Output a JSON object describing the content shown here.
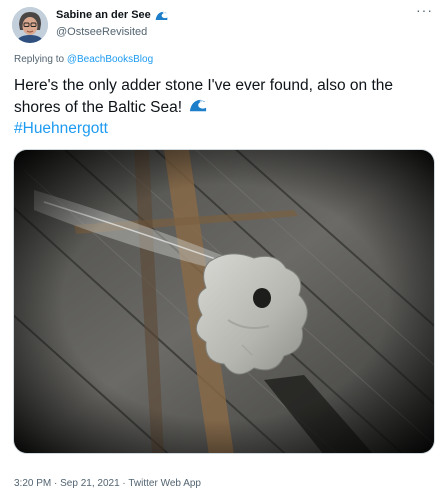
{
  "author": {
    "display_name": "Sabine an der See",
    "name_emoji_icon": "water-wave-icon",
    "handle": "@OstseeRevisited"
  },
  "more_icon": "more-icon",
  "more_label": "···",
  "reply": {
    "prefix": "Replying to ",
    "mention": "@BeachBooksBlog"
  },
  "body": {
    "text": "Here's the only adder stone I've ever found, also on the shores of the Baltic Sea!",
    "emoji_icon": "water-wave-icon",
    "hashtag": "#Huehnergott"
  },
  "meta": {
    "time": "3:20 PM",
    "sep1": " · ",
    "date": "Sep 21, 2021",
    "sep2": " · ",
    "source": "Twitter Web App"
  },
  "colors": {
    "link_blue": "#1d9bf0",
    "wave_blue": "#1d7ec9",
    "text_primary": "#0f1419",
    "text_secondary": "#536471"
  }
}
